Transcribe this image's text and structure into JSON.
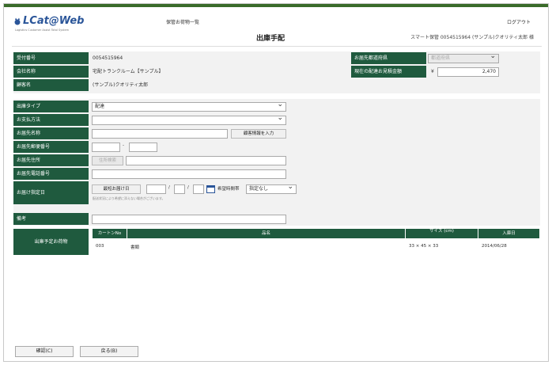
{
  "header": {
    "logo": "LCat@Web",
    "logo_sub": "Logistics Customer Assist Total System",
    "history_link": "保管お荷物一覧",
    "logout": "ログアウト",
    "page_title": "出庫手配",
    "user_info": "スマート保管 0054515964 (サンプル)クオリティ太郎 様"
  },
  "info": {
    "receipt_no_label": "受付番号",
    "receipt_no": "0054515964",
    "company_label": "会社名称",
    "company": "宅配トランクルーム【サンプル】",
    "name_label": "顧客名",
    "name": "(サンプル)クオリティ太郎",
    "pref_label": "お届先都道府県",
    "pref_placeholder": "都道府県",
    "fee_label": "現在の配達お見積金額",
    "fee_currency": "¥",
    "fee_value": "2,470"
  },
  "form": {
    "shipping_type_label": "出庫タイプ",
    "shipping_type_value": "配達",
    "payment_label": "お支払方法",
    "payment_value": "",
    "dest_name_label": "お届先名称",
    "same_as_customer_btn": "顧客情報を入力",
    "zip_label": "お届先郵便番号",
    "address_label": "お届先住所",
    "address_search_btn": "住所検索",
    "phone_label": "お届先電話番号",
    "date_label": "お届け指定日",
    "shortest_btn": "最短お届け日",
    "slash": "/",
    "time_label": "希望時間帯",
    "time_value": "指定なし",
    "date_note": "配送状況により希望に添えない場合がございます。",
    "notes_label": "備考"
  },
  "items": {
    "section_label": "出庫予定お荷物",
    "columns": [
      "カートンNo",
      "品名",
      "サイズ (cm)",
      "入庫日"
    ],
    "rows": [
      {
        "carton": "003",
        "name": "書類",
        "size": "33 × 45 × 33",
        "date": "2014/06/28"
      }
    ]
  },
  "footer": {
    "confirm_btn": "確認(C)",
    "back_btn": "戻る(B)"
  }
}
